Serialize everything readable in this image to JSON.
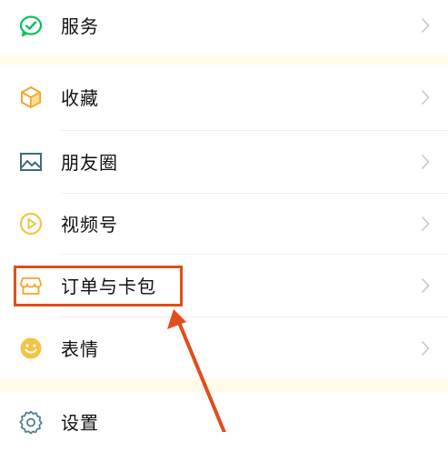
{
  "menu": {
    "items": [
      {
        "label": "服务",
        "icon": "wechat-pay-icon"
      },
      {
        "label": "收藏",
        "icon": "cube-icon"
      },
      {
        "label": "朋友圈",
        "icon": "landscape-photo-icon"
      },
      {
        "label": "视频号",
        "icon": "play-circle-icon"
      },
      {
        "label": "订单与卡包",
        "icon": "storefront-icon"
      },
      {
        "label": "表情",
        "icon": "smile-icon"
      },
      {
        "label": "设置",
        "icon": "gear-icon"
      }
    ]
  },
  "annotation": {
    "highlight_color": "#e24d1c",
    "highlighted_item": "订单与卡包"
  },
  "colors": {
    "green": "#07c160",
    "yellow": "#f5c343",
    "gray": "#6b7f88",
    "chevron": "#c7c7cc",
    "section_gap": "#fffbe8"
  }
}
